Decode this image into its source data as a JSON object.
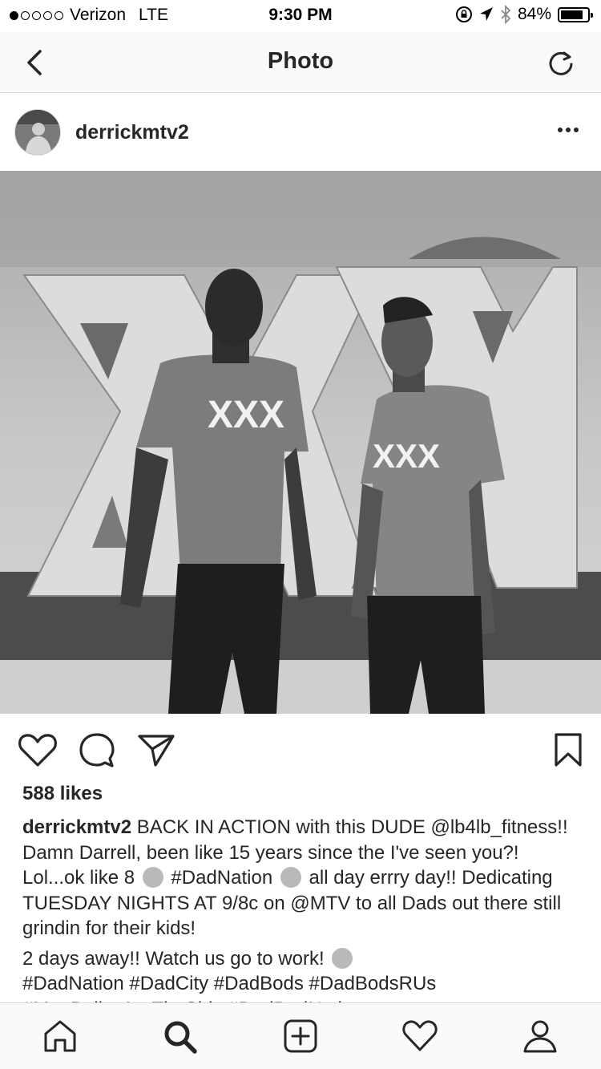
{
  "status_bar": {
    "carrier": "Verizon",
    "network": "LTE",
    "time": "9:30 PM",
    "battery": "84%",
    "battery_level": 0.84,
    "signal_bars_filled": 1,
    "signal_bars_total": 5
  },
  "nav": {
    "title": "Photo",
    "back_icon": "chevron-left-icon",
    "refresh_icon": "refresh-icon"
  },
  "post": {
    "username": "derrickmtv2",
    "more_icon": "ellipsis-icon",
    "photo_shirt_text": "XXX",
    "likes": "588 likes",
    "caption": {
      "username": "derrickmtv2",
      "part1": "BACK IN ACTION with this DUDE @lb4lb_fitness!! Damn Darrell, been like 15 years since the I've seen you?! Lol...ok like 8",
      "part2": "#DadNation",
      "part3": "all day errry day!! Dedicating TUESDAY NIGHTS AT 9/8c on @MTV to all Dads out there still grindin for their kids!",
      "line2": "2 days away!! Watch us go to work!",
      "hashtags": "#DadNation #DadCity #DadBods #DadBodsRUs",
      "hashtags_more": "#ManBellysAreTheShiz #DadBodNation"
    }
  },
  "tabs": [
    {
      "name": "home",
      "icon": "home-icon"
    },
    {
      "name": "search",
      "icon": "search-icon"
    },
    {
      "name": "new-post",
      "icon": "plus-square-icon"
    },
    {
      "name": "activity",
      "icon": "heart-icon"
    },
    {
      "name": "profile",
      "icon": "person-icon"
    }
  ],
  "colors": {
    "text": "#262626",
    "border": "#dbdbdb",
    "bar_bg": "#fafafa"
  }
}
